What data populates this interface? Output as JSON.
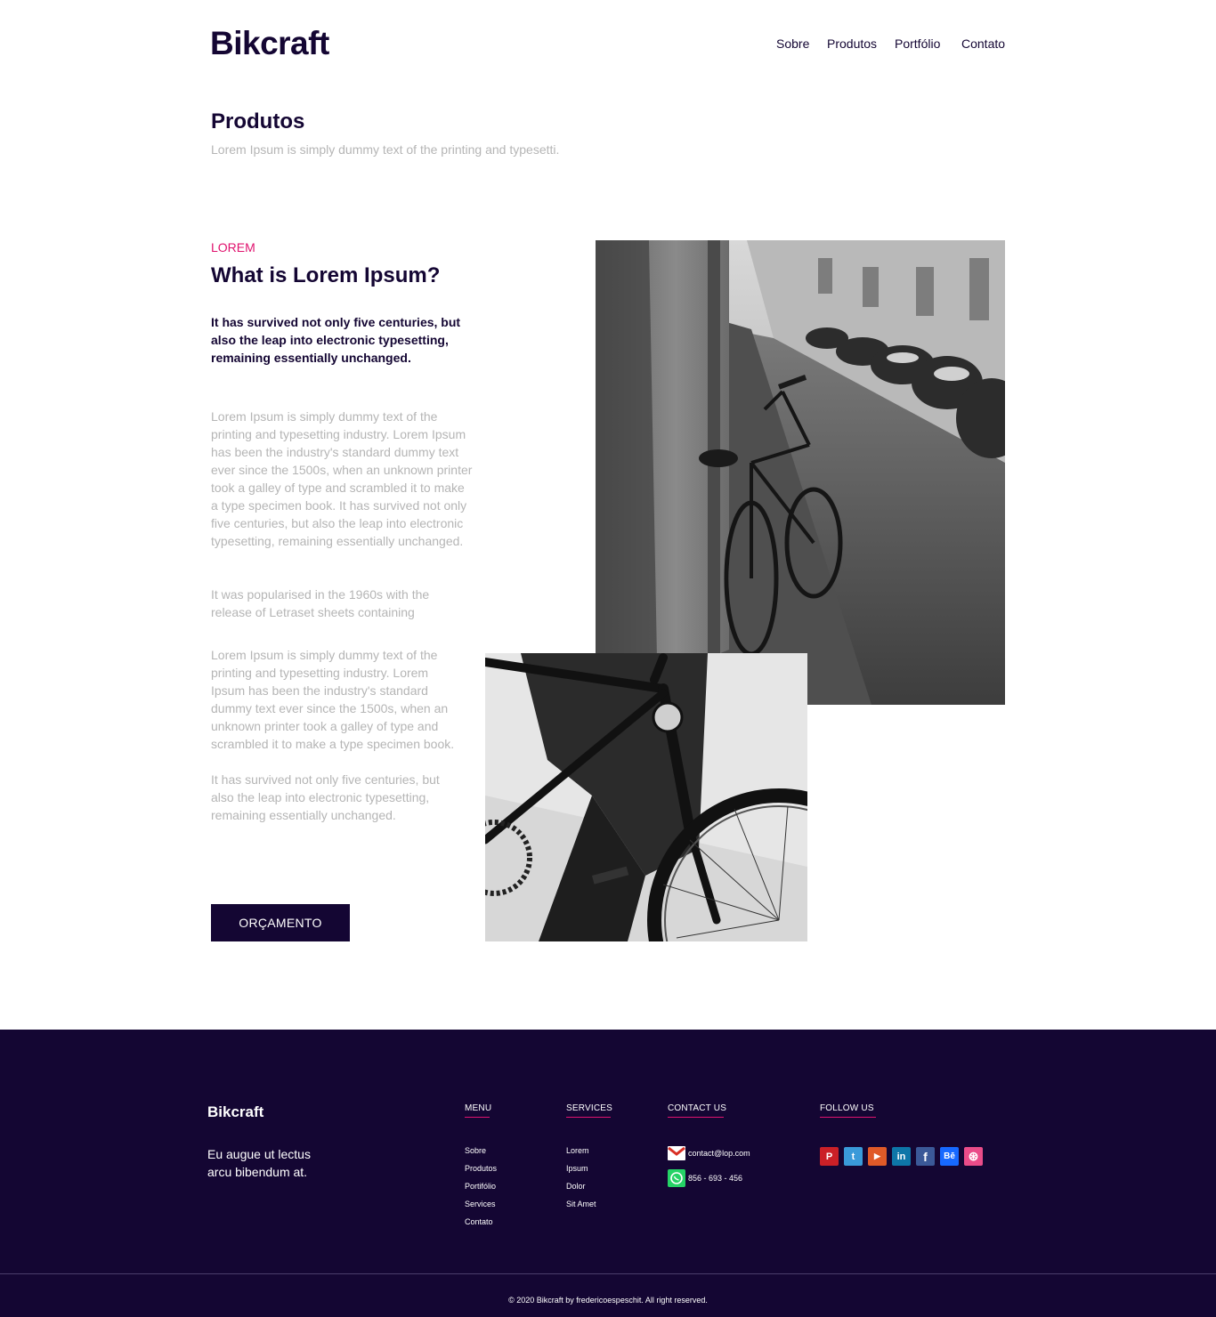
{
  "header": {
    "logo": "Bikcraft",
    "nav": [
      "Sobre",
      "Produtos",
      "Portfólio",
      "Contato"
    ]
  },
  "intro": {
    "title": "Produtos",
    "subtitle": "Lorem Ipsum is simply dummy text of the printing and typesetti."
  },
  "product": {
    "overline": "LOREM",
    "title": "What is Lorem Ipsum?",
    "lead": "It has survived not only five centuries, but also the leap into electronic typesetting, remaining essentially unchanged.",
    "paragraphs": [
      "Lorem Ipsum is simply dummy text of the printing and typesetting industry. Lorem Ipsum has been the industry's standard dummy text ever since the 1500s, when an unknown printer took a galley of type and scrambled it to make a type specimen book. It has survived not only five centuries, but also the leap into electronic typesetting, remaining essentially unchanged.",
      "It was popularised in the 1960s with the release of Letraset sheets containing",
      "Lorem Ipsum is simply dummy text of the printing and typesetting industry. Lorem Ipsum has been the industry's standard dummy text ever since the 1500s, when an unknown printer took a galley of type and scrambled it to make a type specimen book.",
      "It has survived not only five centuries, but also the leap into electronic typesetting, remaining essentially unchanged."
    ],
    "cta_label": "ORÇAMENTO"
  },
  "footer": {
    "logo": "Bikcraft",
    "tagline": "Eu augue ut lectus arcu bibendum at.",
    "menu": {
      "heading": "MENU",
      "items": [
        "Sobre",
        "Produtos",
        "Portifólio",
        "Services",
        "Contato"
      ]
    },
    "services": {
      "heading": "SERVICES",
      "items": [
        "Lorem",
        "Ipsum",
        "Dolor",
        "Sit Amet"
      ]
    },
    "contact": {
      "heading": "CONTACT US",
      "email": "contact@lop.com",
      "phone": "856 - 693 - 456"
    },
    "follow": {
      "heading": "FOLLOW US",
      "networks": [
        {
          "icon": "pinterest-icon",
          "glyph": "P",
          "color": "#cb2027"
        },
        {
          "icon": "twitter-icon",
          "glyph": "t",
          "color": "#3a9ad9"
        },
        {
          "icon": "youtube-icon",
          "glyph": "▶",
          "color": "#e05a28"
        },
        {
          "icon": "linkedin-icon",
          "glyph": "in",
          "color": "#0e76a8"
        },
        {
          "icon": "facebook-icon",
          "glyph": "f",
          "color": "#3b5998"
        },
        {
          "icon": "behance-icon",
          "glyph": "Bē",
          "color": "#1769ff"
        },
        {
          "icon": "dribbble-icon",
          "glyph": "⊛",
          "color": "#ea4c89"
        }
      ]
    },
    "copyright": "© 2020 Bikcraft by fredericoespeschit. All right reserved."
  },
  "colors": {
    "brand": "#140633",
    "accent": "#e0126e",
    "muted_text": "#b5b5b5"
  }
}
